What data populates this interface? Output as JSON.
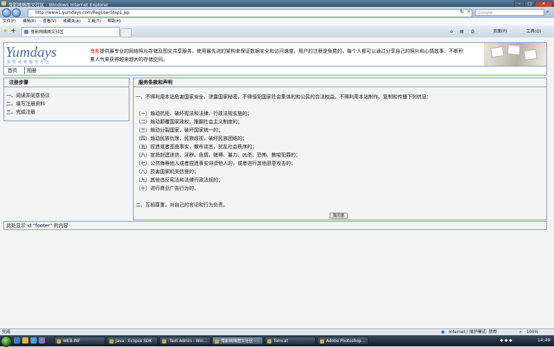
{
  "window": {
    "title": "曳影网络图文社区 - Windows Internet Explorer"
  },
  "address_bar": {
    "url": "http://www1.yumdays.com/RegUserStep1.jsp",
    "search_placeholder": "Google"
  },
  "menu": [
    "文件(F)",
    "编辑(E)",
    "查看(V)",
    "收藏夹(A)",
    "工具(T)",
    "帮助(H)"
  ],
  "tab": {
    "label": "曳影网络图文社区"
  },
  "command_bar": {
    "page_label": "页面(P)",
    "tools_label": "工具(O)"
  },
  "site": {
    "logo": "Yumdays",
    "logo_sub": "曳影网络图文社区",
    "intro_brand": "曳影",
    "intro_text": "提供最专业的网络照片存储及图文共享服务，使用最先进的架构来保证数据安全和访问速度。用户的注册是免费的，每个人都可以通过分享自己的照片和心情故事、不断积累人气来获得越来越大的存储空间。",
    "nav": [
      "首页",
      "相册"
    ]
  },
  "steps_panel": {
    "title": "注册步骤",
    "items": [
      "一、阅读并同意协议",
      "二、填写注册资料",
      "三、完成注册"
    ]
  },
  "terms_panel": {
    "title": "服务条款和声明",
    "intro": "一、不得利用本站危害国家安全、泄露国家秘密，不得侵犯国家社会集体的和公民的合法权益，不得利用本站制作、复制和传播下列信息：",
    "items": [
      "（一）煽动抗拒、破坏宪法和法律、行政法规实施的；",
      "（二）煽动颠覆国家政权，推翻社会主义制度的；",
      "（三）煽动分裂国家、破坏国家统一的；",
      "（四）煽动民族仇恨、民族歧视，破坏民族团结的；",
      "（五）捏造或者歪曲事实，散布谣言，扰乱社会秩序的；",
      "（六）宣扬封建迷信、淫秽、色情、赌博、暴力、凶杀、恐怖、教唆犯罪的；",
      "（七）公然侮辱他人或者捏造事实诽谤他人的，或者进行其他恶意攻击的；",
      "（八）损害国家机关信誉的；",
      "（九）其他违反宪法和法律行政法规的；",
      "（十）进行商业广告行为的。"
    ],
    "second": "二、互相尊重，对自己的言论和行为负责。",
    "agree_button": "我同意"
  },
  "footer": {
    "text": "此处显示  id \"footer\" 的内容"
  },
  "status_bar": {
    "left": "完成",
    "zone": "Internet | 保护模式: 禁用",
    "zoom": "100%"
  },
  "taskbar": {
    "buttons": [
      "WEB-INF",
      "Java - Eclipse SDK",
      ":Text Admin - Win...",
      "曳影网络图文社区 -...",
      "Tomcat",
      "Adobe Photoshop..."
    ],
    "clock": "14:49"
  }
}
